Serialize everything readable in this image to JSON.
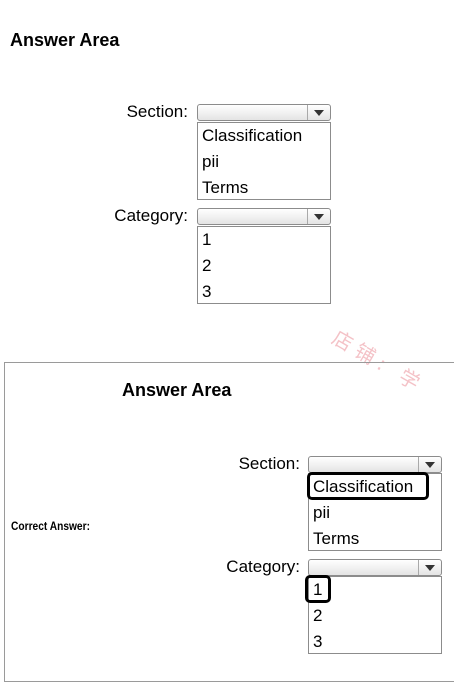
{
  "question": {
    "title": "Answer Area",
    "section": {
      "label": "Section:",
      "options": [
        "Classification",
        "pii",
        "Terms"
      ]
    },
    "category": {
      "label": "Category:",
      "options": [
        "1",
        "2",
        "3"
      ]
    }
  },
  "answer": {
    "side_label": "Correct Answer:",
    "title": "Answer Area",
    "section": {
      "label": "Section:",
      "options": [
        "Classification",
        "pii",
        "Terms"
      ],
      "selected": "Classification"
    },
    "category": {
      "label": "Category:",
      "options": [
        "1",
        "2",
        "3"
      ],
      "selected": "1"
    }
  },
  "watermark": "店铺: 学"
}
